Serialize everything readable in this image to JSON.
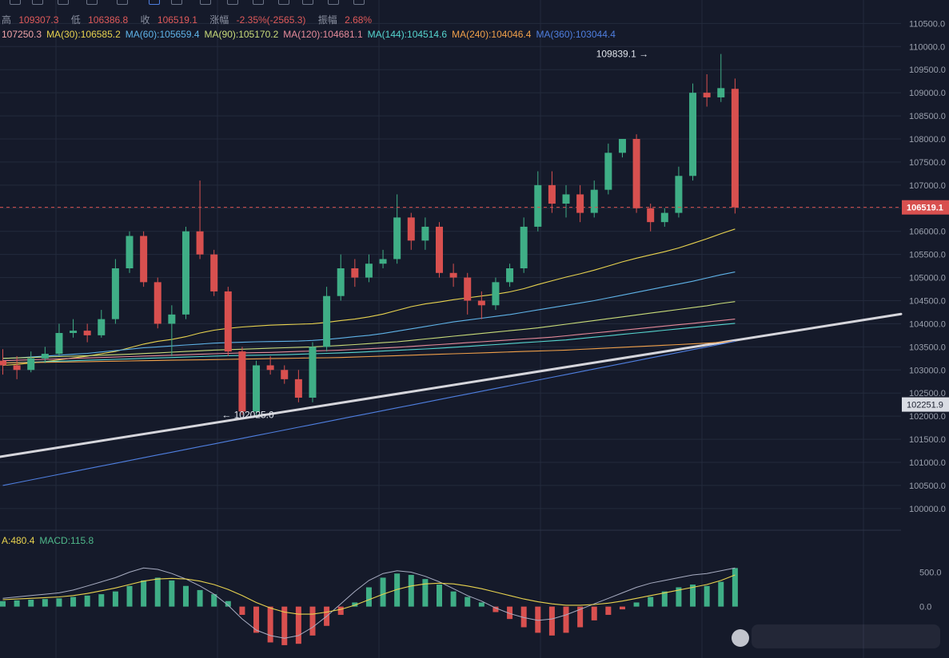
{
  "header": {
    "line1": [
      {
        "label": "高",
        "value": "109307.3"
      },
      {
        "label": "低",
        "value": "106386.8"
      },
      {
        "label": "收",
        "value": "106519.1"
      },
      {
        "label": "涨幅",
        "value": "-2.35%(-2565.3)"
      },
      {
        "label": "振幅",
        "value": "2.68%"
      }
    ],
    "ma_line": [
      {
        "text": "107250.3",
        "color": "#f0a3a8"
      },
      {
        "text": "MA(30):106585.2",
        "color": "#e8d34f"
      },
      {
        "text": "MA(60):105659.4",
        "color": "#5fb3e8"
      },
      {
        "text": "MA(90):105170.2",
        "color": "#c9dc7a"
      },
      {
        "text": "MA(120):104681.1",
        "color": "#e58a9a"
      },
      {
        "text": "MA(144):104514.6",
        "color": "#56d6d0"
      },
      {
        "text": "MA(240):104046.4",
        "color": "#f0a04a"
      },
      {
        "text": "MA(360):103044.4",
        "color": "#4f7fe0"
      }
    ]
  },
  "macd_header": [
    {
      "text": "A:480.4",
      "color": "#e8d34f"
    },
    {
      "text": "MACD:115.8",
      "color": "#4fb88a"
    }
  ],
  "colors": {
    "up": "#3fae86",
    "down": "#d8504f",
    "background": "#151a2a",
    "grid": "#232a3c",
    "axis_text": "#9aa0ad",
    "trendline": "#d6d6dc"
  },
  "chart_data": {
    "type": "candlestick",
    "y_axis_ticks": [
      100000,
      100500,
      101000,
      101500,
      102000,
      102500,
      103000,
      103500,
      104000,
      104500,
      105000,
      105500,
      106000,
      106500,
      107000,
      107500,
      108000,
      108500,
      109000,
      109500,
      110000,
      110500
    ],
    "ylim": [
      99600,
      110800
    ],
    "current_price_label": "106519.1",
    "side_price_label": "102251.9",
    "annotations": [
      {
        "text": "109839.1 →",
        "x": 46,
        "price": 109839.1
      },
      {
        "text": "← 102025.0",
        "x": 16,
        "price": 102025.0
      }
    ],
    "candles": [
      {
        "o": 103200,
        "c": 103100,
        "h": 103450,
        "l": 102900
      },
      {
        "o": 103100,
        "c": 103000,
        "h": 103300,
        "l": 102800
      },
      {
        "o": 103000,
        "c": 103250,
        "h": 103400,
        "l": 102950
      },
      {
        "o": 103250,
        "c": 103350,
        "h": 103500,
        "l": 103150
      },
      {
        "o": 103350,
        "c": 103800,
        "h": 104000,
        "l": 103300
      },
      {
        "o": 103800,
        "c": 103850,
        "h": 104100,
        "l": 103700
      },
      {
        "o": 103850,
        "c": 103750,
        "h": 104000,
        "l": 103600
      },
      {
        "o": 103750,
        "c": 104100,
        "h": 104300,
        "l": 103700
      },
      {
        "o": 104100,
        "c": 105200,
        "h": 105400,
        "l": 104000
      },
      {
        "o": 105200,
        "c": 105900,
        "h": 106000,
        "l": 105100
      },
      {
        "o": 105900,
        "c": 104900,
        "h": 106000,
        "l": 104800
      },
      {
        "o": 104900,
        "c": 104000,
        "h": 105000,
        "l": 103900
      },
      {
        "o": 104000,
        "c": 104200,
        "h": 104400,
        "l": 103300
      },
      {
        "o": 104200,
        "c": 106000,
        "h": 106100,
        "l": 104100
      },
      {
        "o": 106000,
        "c": 105500,
        "h": 107100,
        "l": 105400
      },
      {
        "o": 105500,
        "c": 104700,
        "h": 105600,
        "l": 104600
      },
      {
        "o": 104700,
        "c": 103400,
        "h": 104800,
        "l": 103300
      },
      {
        "o": 103400,
        "c": 102100,
        "h": 103500,
        "l": 102025
      },
      {
        "o": 102100,
        "c": 103100,
        "h": 103200,
        "l": 102025
      },
      {
        "o": 103100,
        "c": 103000,
        "h": 103300,
        "l": 102900
      },
      {
        "o": 103000,
        "c": 102800,
        "h": 103100,
        "l": 102700
      },
      {
        "o": 102800,
        "c": 102400,
        "h": 103000,
        "l": 102300
      },
      {
        "o": 102400,
        "c": 103500,
        "h": 103600,
        "l": 102300
      },
      {
        "o": 103500,
        "c": 104600,
        "h": 104800,
        "l": 103400
      },
      {
        "o": 104600,
        "c": 105200,
        "h": 105500,
        "l": 104500
      },
      {
        "o": 105200,
        "c": 105000,
        "h": 105400,
        "l": 104800
      },
      {
        "o": 105000,
        "c": 105300,
        "h": 105500,
        "l": 104900
      },
      {
        "o": 105300,
        "c": 105400,
        "h": 105600,
        "l": 105200
      },
      {
        "o": 105400,
        "c": 106300,
        "h": 106800,
        "l": 105300
      },
      {
        "o": 106300,
        "c": 105800,
        "h": 106400,
        "l": 105600
      },
      {
        "o": 105800,
        "c": 106100,
        "h": 106300,
        "l": 105600
      },
      {
        "o": 106100,
        "c": 105100,
        "h": 106200,
        "l": 105000
      },
      {
        "o": 105100,
        "c": 105000,
        "h": 105300,
        "l": 104800
      },
      {
        "o": 105000,
        "c": 104500,
        "h": 105100,
        "l": 104200
      },
      {
        "o": 104500,
        "c": 104400,
        "h": 104700,
        "l": 104100
      },
      {
        "o": 104400,
        "c": 104900,
        "h": 105000,
        "l": 104300
      },
      {
        "o": 104900,
        "c": 105200,
        "h": 105300,
        "l": 104800
      },
      {
        "o": 105200,
        "c": 106100,
        "h": 106300,
        "l": 105100
      },
      {
        "o": 106100,
        "c": 107000,
        "h": 107300,
        "l": 106000
      },
      {
        "o": 107000,
        "c": 106600,
        "h": 107300,
        "l": 106400
      },
      {
        "o": 106600,
        "c": 106800,
        "h": 107000,
        "l": 106300
      },
      {
        "o": 106800,
        "c": 106400,
        "h": 107000,
        "l": 106200
      },
      {
        "o": 106400,
        "c": 106900,
        "h": 107100,
        "l": 106300
      },
      {
        "o": 106900,
        "c": 107700,
        "h": 107900,
        "l": 106800
      },
      {
        "o": 107700,
        "c": 108000,
        "h": 108000,
        "l": 107600
      },
      {
        "o": 108000,
        "c": 106500,
        "h": 108100,
        "l": 106400
      },
      {
        "o": 106500,
        "c": 106200,
        "h": 106600,
        "l": 106000
      },
      {
        "o": 106200,
        "c": 106400,
        "h": 106500,
        "l": 106100
      },
      {
        "o": 106400,
        "c": 107200,
        "h": 107400,
        "l": 106300
      },
      {
        "o": 107200,
        "c": 109000,
        "h": 109200,
        "l": 107100
      },
      {
        "o": 109000,
        "c": 108900,
        "h": 109400,
        "l": 108700
      },
      {
        "o": 108900,
        "c": 109100,
        "h": 109839.1,
        "l": 108800
      },
      {
        "o": 109084.4,
        "c": 106519.1,
        "h": 109307.3,
        "l": 106386.8
      }
    ],
    "series": [
      {
        "name": "MA(30)",
        "color": "#e8d34f",
        "values": [
          103100,
          103120,
          103150,
          103180,
          103220,
          103260,
          103300,
          103350,
          103400,
          103480,
          103560,
          103620,
          103660,
          103720,
          103800,
          103860,
          103900,
          103930,
          103950,
          103970,
          103980,
          103990,
          104000,
          104030,
          104070,
          104100,
          104150,
          104210,
          104290,
          104370,
          104430,
          104470,
          104520,
          104560,
          104600,
          104640,
          104690,
          104760,
          104850,
          104930,
          105010,
          105080,
          105160,
          105250,
          105340,
          105420,
          105490,
          105560,
          105640,
          105740,
          105840,
          105950,
          106050
        ]
      },
      {
        "name": "MA(60)",
        "color": "#5fb3e8",
        "values": [
          103250,
          103260,
          103280,
          103300,
          103320,
          103340,
          103360,
          103390,
          103420,
          103450,
          103480,
          103500,
          103520,
          103540,
          103560,
          103580,
          103590,
          103600,
          103610,
          103615,
          103620,
          103625,
          103640,
          103660,
          103690,
          103720,
          103750,
          103790,
          103840,
          103890,
          103940,
          103990,
          104040,
          104080,
          104120,
          104160,
          104200,
          104250,
          104300,
          104350,
          104400,
          104450,
          104500,
          104560,
          104620,
          104680,
          104740,
          104800,
          104860,
          104920,
          104990,
          105060,
          105120
        ]
      },
      {
        "name": "MA(90)",
        "color": "#c9dc7a",
        "values": [
          103250,
          103260,
          103270,
          103280,
          103290,
          103300,
          103310,
          103320,
          103330,
          103340,
          103355,
          103370,
          103385,
          103400,
          103415,
          103430,
          103440,
          103450,
          103460,
          103470,
          103480,
          103490,
          103500,
          103515,
          103530,
          103550,
          103570,
          103590,
          103610,
          103640,
          103670,
          103700,
          103730,
          103760,
          103790,
          103820,
          103850,
          103880,
          103910,
          103950,
          103990,
          104030,
          104070,
          104110,
          104150,
          104190,
          104230,
          104270,
          104310,
          104350,
          104390,
          104440,
          104480
        ]
      },
      {
        "name": "MA(120)",
        "color": "#e58a9a",
        "values": [
          103200,
          103210,
          103220,
          103230,
          103240,
          103250,
          103260,
          103270,
          103280,
          103290,
          103300,
          103310,
          103320,
          103330,
          103340,
          103350,
          103360,
          103370,
          103375,
          103380,
          103390,
          103400,
          103410,
          103420,
          103430,
          103445,
          103460,
          103475,
          103490,
          103510,
          103530,
          103550,
          103570,
          103590,
          103610,
          103630,
          103650,
          103670,
          103690,
          103710,
          103740,
          103770,
          103800,
          103830,
          103860,
          103890,
          103920,
          103950,
          103980,
          104010,
          104040,
          104070,
          104100
        ]
      },
      {
        "name": "MA(144)",
        "color": "#56d6d0",
        "values": [
          103150,
          103160,
          103170,
          103180,
          103190,
          103200,
          103210,
          103220,
          103230,
          103240,
          103250,
          103260,
          103270,
          103280,
          103290,
          103300,
          103310,
          103315,
          103320,
          103325,
          103330,
          103340,
          103350,
          103360,
          103370,
          103380,
          103395,
          103410,
          103425,
          103440,
          103455,
          103470,
          103490,
          103510,
          103530,
          103550,
          103570,
          103590,
          103610,
          103630,
          103650,
          103680,
          103710,
          103740,
          103770,
          103800,
          103830,
          103860,
          103890,
          103920,
          103950,
          103980,
          104010
        ]
      },
      {
        "name": "MA(240)",
        "color": "#f0a04a",
        "values": [
          103150,
          103155,
          103160,
          103165,
          103170,
          103175,
          103180,
          103185,
          103190,
          103195,
          103200,
          103205,
          103210,
          103215,
          103220,
          103225,
          103230,
          103235,
          103240,
          103245,
          103250,
          103255,
          103260,
          103265,
          103270,
          103280,
          103290,
          103300,
          103310,
          103320,
          103330,
          103340,
          103350,
          103360,
          103370,
          103380,
          103390,
          103400,
          103410,
          103420,
          103430,
          103445,
          103460,
          103475,
          103490,
          103505,
          103520,
          103535,
          103550,
          103565,
          103580,
          103600,
          103620
        ]
      },
      {
        "name": "MA(360)",
        "color": "#4f7fe0",
        "values": [
          100500,
          100560,
          100620,
          100680,
          100740,
          100800,
          100860,
          100920,
          100980,
          101040,
          101100,
          101160,
          101220,
          101280,
          101340,
          101400,
          101460,
          101520,
          101580,
          101640,
          101700,
          101760,
          101820,
          101880,
          101940,
          102000,
          102060,
          102120,
          102180,
          102240,
          102300,
          102360,
          102420,
          102480,
          102540,
          102600,
          102660,
          102720,
          102780,
          102840,
          102900,
          102960,
          103020,
          103080,
          103140,
          103200,
          103260,
          103320,
          103380,
          103440,
          103500,
          103560,
          103620
        ]
      }
    ],
    "macd": {
      "y_ticks": [
        0,
        500
      ],
      "ylim": [
        -700,
        900
      ],
      "hist": [
        80,
        90,
        100,
        110,
        120,
        140,
        160,
        180,
        220,
        300,
        380,
        420,
        380,
        300,
        240,
        180,
        80,
        -120,
        -380,
        -520,
        -560,
        -540,
        -420,
        -280,
        -120,
        60,
        280,
        420,
        480,
        460,
        400,
        320,
        220,
        140,
        60,
        -80,
        -180,
        -300,
        -380,
        -420,
        -380,
        -300,
        -200,
        -120,
        -40,
        60,
        140,
        220,
        280,
        320,
        300,
        360,
        560
      ],
      "dif": [
        120,
        140,
        160,
        180,
        200,
        240,
        300,
        360,
        420,
        500,
        560,
        540,
        480,
        400,
        300,
        180,
        20,
        -180,
        -340,
        -420,
        -460,
        -420,
        -300,
        -140,
        40,
        220,
        380,
        480,
        520,
        500,
        440,
        360,
        260,
        160,
        80,
        -20,
        -100,
        -160,
        -200,
        -180,
        -120,
        -40,
        40,
        120,
        200,
        280,
        340,
        380,
        420,
        460,
        480,
        520,
        560
      ],
      "dea": [
        100,
        110,
        120,
        130,
        140,
        160,
        190,
        230,
        270,
        320,
        370,
        400,
        410,
        400,
        370,
        320,
        250,
        160,
        60,
        -20,
        -80,
        -110,
        -110,
        -80,
        -40,
        20,
        100,
        180,
        250,
        300,
        330,
        340,
        330,
        300,
        260,
        210,
        160,
        110,
        70,
        40,
        20,
        20,
        30,
        50,
        80,
        120,
        160,
        200,
        240,
        280,
        320,
        380,
        460
      ]
    }
  }
}
